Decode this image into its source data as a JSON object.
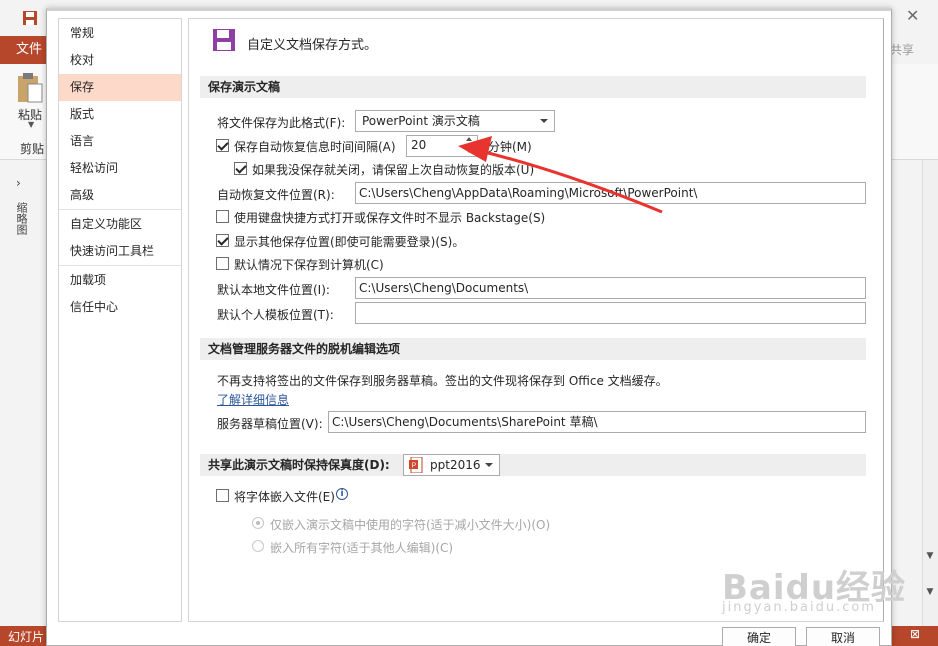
{
  "background": {
    "file_tab": "文件",
    "share": "共享",
    "paste": "粘贴",
    "clipboard": "剪贴",
    "thumbnails": "缩略图",
    "status_left": "幻灯片",
    "brand_color": "#b7472a"
  },
  "nav": {
    "items": [
      "常规",
      "校对",
      "保存",
      "版式",
      "语言",
      "轻松访问",
      "高级",
      "自定义功能区",
      "快速访问工具栏",
      "加载项",
      "信任中心"
    ],
    "selected": "保存"
  },
  "header": {
    "title": "自定义文档保存方式。"
  },
  "sections": {
    "save_presentations": "保存演示文稿",
    "offline_editing": "文档管理服务器文件的脱机编辑选项",
    "fidelity": "共享此演示文稿时保持保真度(D):"
  },
  "save": {
    "format_label": "将文件保存为此格式(F):",
    "format_value": "PowerPoint 演示文稿",
    "autorecover_label": "保存自动恢复信息时间间隔(A)",
    "autorecover_value": "20",
    "autorecover_checked": true,
    "minutes_label": "分钟(M)",
    "keep_last_label": "如果我没保存就关闭，请保留上次自动恢复的版本(U)",
    "keep_last_checked": true,
    "autorecover_location_label": "自动恢复文件位置(R):",
    "autorecover_location_value": "C:\\Users\\Cheng\\AppData\\Roaming\\Microsoft\\PowerPoint\\",
    "no_backstage_label": "使用键盘快捷方式打开或保存文件时不显示 Backstage(S)",
    "no_backstage_checked": false,
    "show_additional_label": "显示其他保存位置(即使可能需要登录)(S)。",
    "show_additional_checked": true,
    "save_to_computer_label": "默认情况下保存到计算机(C)",
    "save_to_computer_checked": false,
    "default_local_label": "默认本地文件位置(I):",
    "default_local_value": "C:\\Users\\Cheng\\Documents\\",
    "default_template_label": "默认个人模板位置(T):",
    "default_template_value": ""
  },
  "offline": {
    "notice": "不再支持将签出的文件保存到服务器草稿。签出的文件现将保存到 Office 文档缓存。",
    "learn_more": "了解详细信息",
    "drafts_label": "服务器草稿位置(V):",
    "drafts_value": "C:\\Users\\Cheng\\Documents\\SharePoint 草稿\\"
  },
  "fidelity": {
    "file_value": "ppt2016",
    "embed_fonts_label": "将字体嵌入文件(E)",
    "embed_fonts_checked": false,
    "embed_used_label": "仅嵌入演示文稿中使用的字符(适于减小文件大小)(O)",
    "embed_all_label": "嵌入所有字符(适于其他人编辑)(C)"
  },
  "buttons": {
    "ok": "确定",
    "cancel": "取消"
  },
  "watermark": {
    "brand": "Baidu经验",
    "url": "jingyan.baidu.com"
  },
  "colors": {
    "selected_nav": "#fcd9c9",
    "arrow": "#e8332e",
    "link": "#2b579a"
  }
}
